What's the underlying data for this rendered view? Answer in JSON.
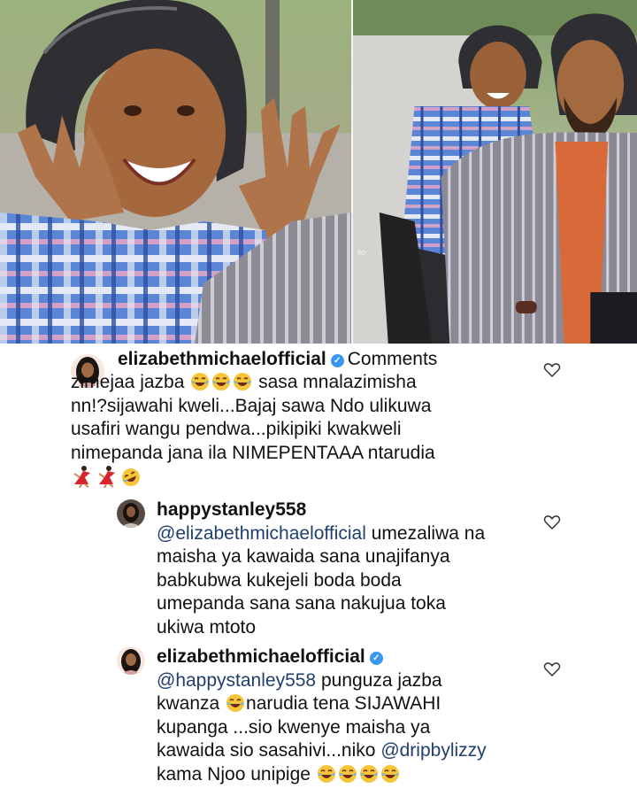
{
  "photos": {
    "left_alt": "",
    "right_watermark": "ilo"
  },
  "comments": [
    {
      "username": "elizabethmichaelofficial",
      "verified": true,
      "lines": [
        {
          "segments": [
            "Comments"
          ]
        },
        {
          "segments": [
            "zimejaa jazba",
            "😂",
            "😂",
            "😂",
            "sasa mnalazimisha"
          ]
        },
        {
          "segments": [
            "nn!?sijawahi kweli...Bajaj sawa Ndo ulikuwa"
          ]
        },
        {
          "segments": [
            "usafiri wangu pendwa...pikipiki kwakweli"
          ]
        },
        {
          "segments": [
            "nimepanda jana ila NIMEPENTAAA ntarudia"
          ]
        }
      ],
      "emoji_line": [
        "💃",
        "💃",
        "🤣"
      ]
    },
    {
      "username": "happystanley558",
      "verified": false,
      "mention": "@elizabethmichaelofficial",
      "line1_rest": "umezaliwa na",
      "lines": [
        "maisha ya kawaida sana unajifanya",
        "babkubwa kukejeli boda boda",
        "umepanda sana sana nakujua toka",
        "ukiwa mtoto"
      ]
    },
    {
      "username": "elizabethmichaelofficial",
      "verified": true,
      "mention": "@happystanley558",
      "line1_rest": "punguza jazba",
      "line2_a": "kwanza",
      "line2_b": "narudia tena SIJAWAHI",
      "lines": [
        "kupanga ...sio kwenye maisha ya"
      ],
      "line4_a": "kawaida sio sasahivi...niko",
      "line4_mention": "@dripbylizzy",
      "line5": "kama Njoo unipige"
    }
  ],
  "icons": {
    "like": "heart-outline-icon",
    "verified": "verified-badge-icon",
    "laugh": "face-with-tears-of-joy-emoji",
    "rofl": "rolling-on-floor-laughing-emoji",
    "dancer": "dancer-emoji"
  },
  "colors": {
    "verified": "#3897f0",
    "mention": "#1f3f6e",
    "text": "#111111"
  }
}
